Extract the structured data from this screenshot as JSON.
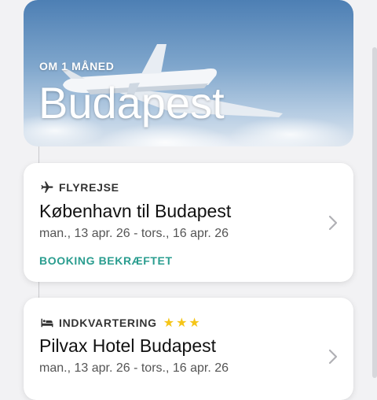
{
  "hero": {
    "eyebrow": "OM 1 MÅNED",
    "city": "Budapest"
  },
  "flight_card": {
    "kind_icon": "airplane-icon",
    "kind_label": "FLYREJSE",
    "title": "København til Budapest",
    "dates": "man., 13 apr. 26 - tors., 16 apr. 26",
    "status": "BOOKING BEKRÆFTET"
  },
  "hotel_card": {
    "kind_icon": "bed-icon",
    "kind_label": "INDKVARTERING",
    "stars": "★★★",
    "star_rating": 3,
    "title": "Pilvax Hotel Budapest",
    "dates": "man., 13 apr. 26 - tors., 16 apr. 26"
  },
  "colors": {
    "accent_status": "#2a9d8f",
    "star": "#f5c518",
    "background": "#f2f2f4"
  }
}
